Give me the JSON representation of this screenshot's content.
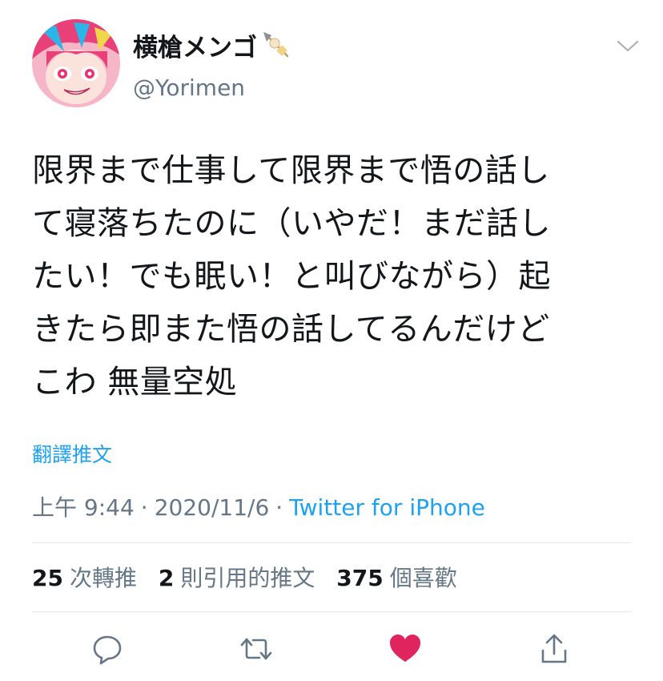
{
  "user": {
    "display_name": "横槍メンゴ",
    "name_emoji": "oden-skewer-emoji",
    "handle": "@Yorimen",
    "avatar": "avatar-anime-girl-pink-hair"
  },
  "tweet": {
    "lines": [
      "限界まで仕事して限界まで悟の話し",
      "て寝落ちたのに（いやだ！まだ話し",
      "たい！でも眠い！と叫びながら）起",
      "きたら即また悟の話してるんだけど",
      "こわ 無量空処"
    ],
    "translate_label": "翻譯推文"
  },
  "meta": {
    "time": "上午 9:44",
    "separator": "·",
    "date": "2020/11/6",
    "source": "Twitter for iPhone"
  },
  "stats": {
    "retweets": {
      "count": "25",
      "label": "次轉推"
    },
    "quotes": {
      "count": "2",
      "label": "則引用的推文"
    },
    "likes": {
      "count": "375",
      "label": "個喜歡"
    }
  },
  "actions": {
    "reply_icon": "reply-icon",
    "retweet_icon": "retweet-icon",
    "like_icon": "heart-icon",
    "share_icon": "share-icon"
  },
  "colors": {
    "accent": "#1da1f2",
    "like": "#e0245e",
    "muted": "#657786",
    "divider": "#e1e8ed"
  }
}
